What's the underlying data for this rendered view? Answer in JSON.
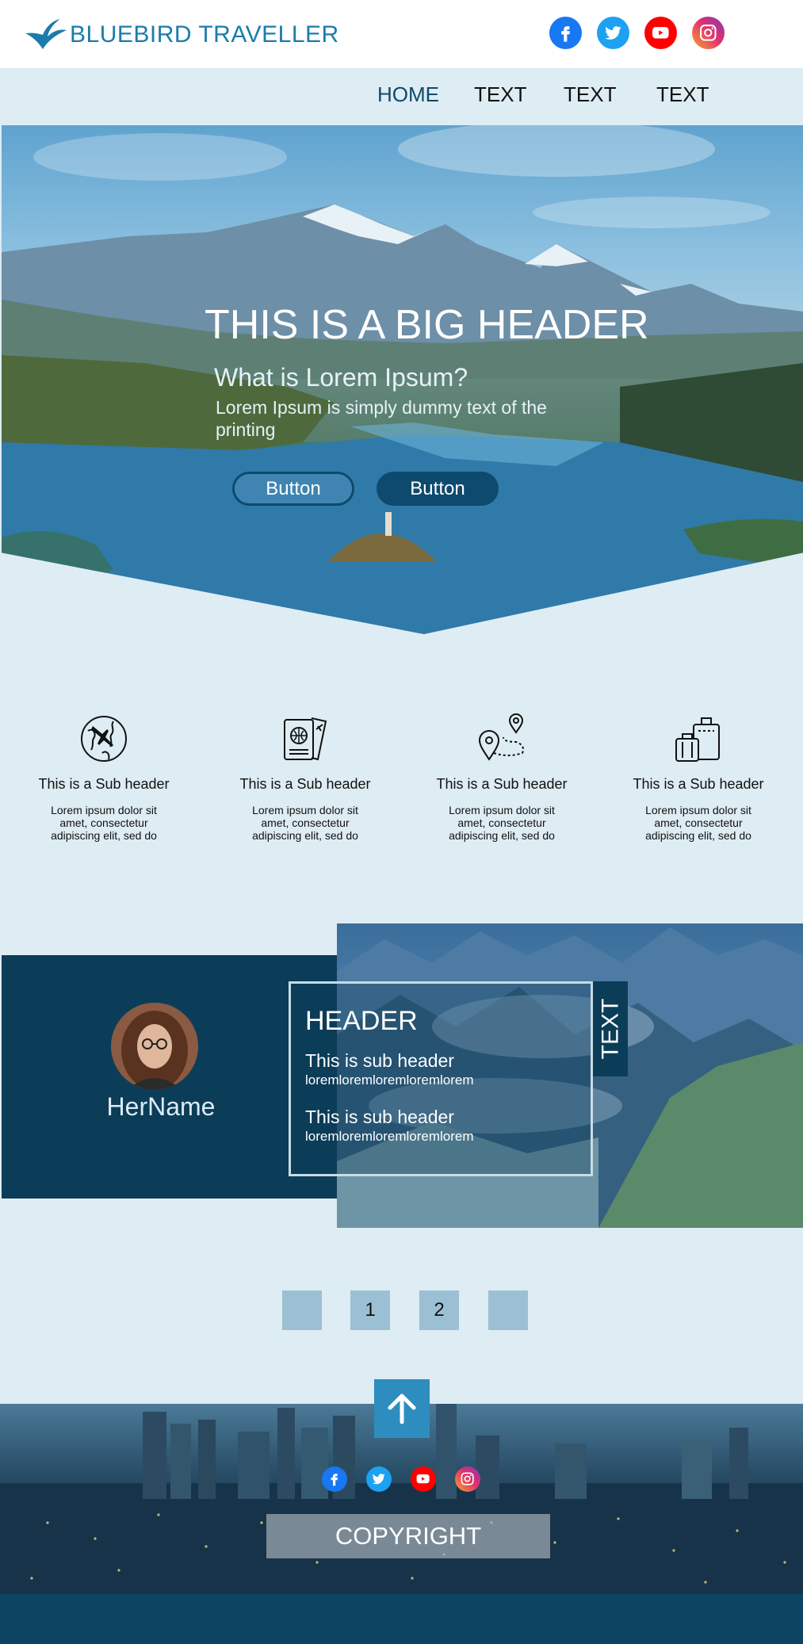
{
  "brand": {
    "name": "BLUEBIRD TRAVELLER"
  },
  "social": [
    {
      "icon": "facebook-icon"
    },
    {
      "icon": "twitter-icon"
    },
    {
      "icon": "youtube-icon"
    },
    {
      "icon": "instagram-icon"
    }
  ],
  "nav": {
    "items": [
      "HOME",
      "TEXT",
      "TEXT",
      "TEXT"
    ],
    "active": "HOME"
  },
  "hero": {
    "title": "THIS IS A BIG HEADER",
    "subtitle": "What is Lorem Ipsum?",
    "description": "Lorem Ipsum is simply dummy text of the printing",
    "button_outline": "Button",
    "button_solid": "Button"
  },
  "features": [
    {
      "icon": "globe-plane-icon",
      "title": "This is a Sub header",
      "text": "Lorem ipsum dolor sit amet, consectetur adipiscing elit, sed do"
    },
    {
      "icon": "passport-ticket-icon",
      "title": "This is a Sub header",
      "text": "Lorem ipsum dolor sit amet, consectetur adipiscing elit, sed do"
    },
    {
      "icon": "route-pin-icon",
      "title": "This is a Sub header",
      "text": "Lorem ipsum dolor sit amet, consectetur adipiscing elit, sed do"
    },
    {
      "icon": "luggage-icon",
      "title": "This is a Sub header",
      "text": "Lorem ipsum dolor sit amet, consectetur adipiscing elit, sed do"
    }
  ],
  "profile": {
    "name": "HerName",
    "box_header": "HEADER",
    "items": [
      {
        "sub": "This is sub header",
        "text": "loremloremloremloremlorem"
      },
      {
        "sub": "This is sub header",
        "text": "loremloremloremloremlorem"
      }
    ],
    "tab": "TEXT"
  },
  "pagination": {
    "pages": [
      "",
      "1",
      "2",
      ""
    ]
  },
  "footer": {
    "copyright": "COPYRIGHT"
  },
  "colors": {
    "brand": "#1b7cab",
    "dark": "#0c3d58",
    "background": "#deecf3",
    "accent": "#2e8dbf"
  }
}
